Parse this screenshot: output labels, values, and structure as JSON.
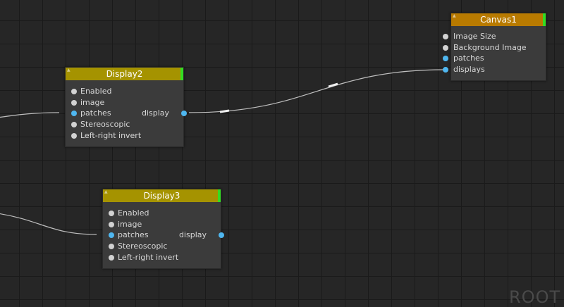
{
  "nodes": {
    "display2": {
      "title": "Display2",
      "header_color": "#a59300",
      "inputs": [
        "Enabled",
        "image",
        "patches",
        "Stereoscopic",
        "Left-right invert"
      ],
      "output": "display"
    },
    "display3": {
      "title": "Display3",
      "header_color": "#a59300",
      "inputs": [
        "Enabled",
        "image",
        "patches",
        "Stereoscopic",
        "Left-right invert"
      ],
      "output": "display"
    },
    "canvas1": {
      "title": "Canvas1",
      "header_color": "#b87a00",
      "inputs": [
        "Image Size",
        "Background Image",
        "patches",
        "displays"
      ]
    }
  },
  "canvas": {
    "root_label": "ROOT"
  },
  "colors": {
    "status_ok": "#33dd22",
    "port_data": "#4fb7f0",
    "port_param": "#d2d2d2",
    "wire": "#bfbfbf"
  }
}
